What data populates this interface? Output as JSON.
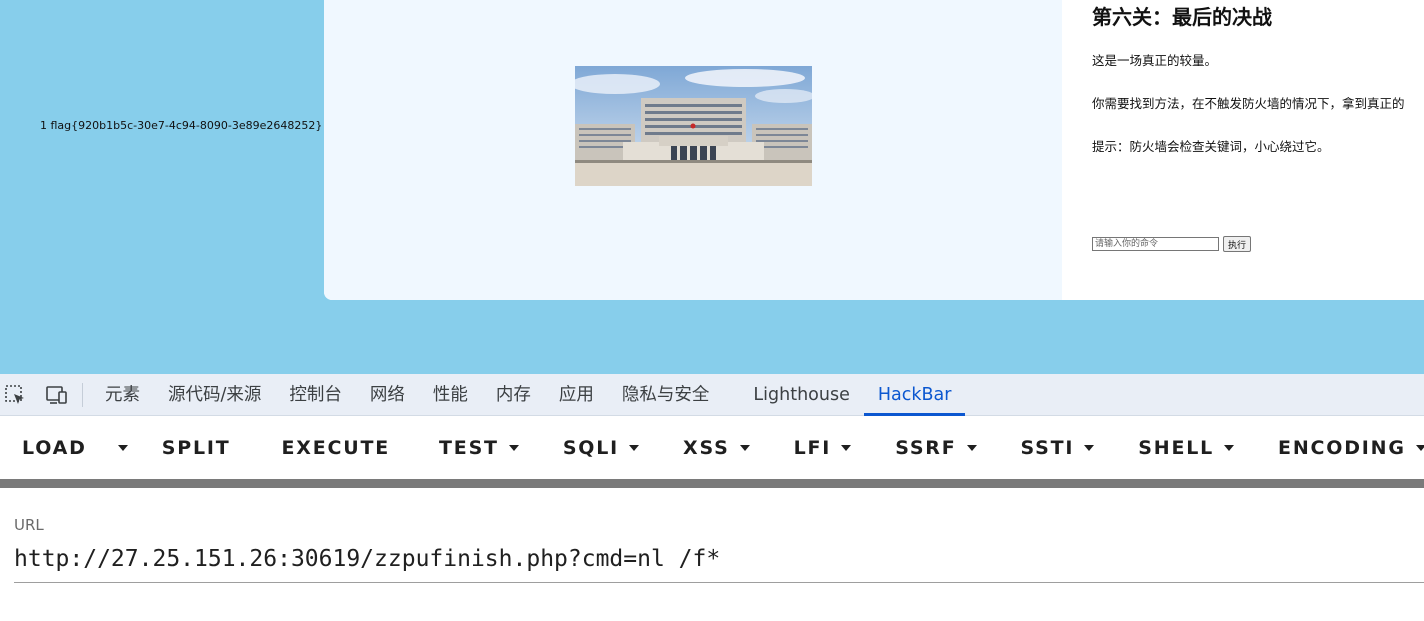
{
  "page": {
    "flag_output": "1 flag{920b1b5c-30e7-4c94-8090-3e89e2648252}",
    "level_title": "第六关：最后的决战",
    "descriptions": [
      "这是一场真正的较量。",
      "你需要找到方法，在不触发防火墙的情况下，拿到真正的",
      "提示：防火墙会检查关键词，小心绕过它。"
    ],
    "command_placeholder": "请输入你的命令",
    "execute_button": "执行",
    "image_subject": "government-building-photo"
  },
  "devtools": {
    "tool_icons": [
      "inspect-element-icon",
      "device-toolbar-icon"
    ],
    "tabs": [
      "元素",
      "源代码/来源",
      "控制台",
      "网络",
      "性能",
      "内存",
      "应用",
      "隐私与安全",
      "Lighthouse",
      "HackBar"
    ],
    "active_tab": "HackBar",
    "accent_color": "#0b57d0"
  },
  "hackbar": {
    "buttons": [
      {
        "label": "LOAD",
        "dropdown": false
      },
      {
        "label": "SPLIT",
        "dropdown": false
      },
      {
        "label": "EXECUTE",
        "dropdown": false
      },
      {
        "label": "TEST",
        "dropdown": true
      },
      {
        "label": "SQLI",
        "dropdown": true
      },
      {
        "label": "XSS",
        "dropdown": true
      },
      {
        "label": "LFI",
        "dropdown": true
      },
      {
        "label": "SSRF",
        "dropdown": true
      },
      {
        "label": "SSTI",
        "dropdown": true
      },
      {
        "label": "SHELL",
        "dropdown": true
      },
      {
        "label": "ENCODING",
        "dropdown": true
      }
    ],
    "url_label": "URL",
    "url_value": "http://27.25.151.26:30619/zzpufinish.php?cmd=nl /f*"
  },
  "colors": {
    "page_background": "#87ceeb",
    "card_left_background": "#f0f8ff",
    "devtools_tab_background": "#e9eef6"
  }
}
